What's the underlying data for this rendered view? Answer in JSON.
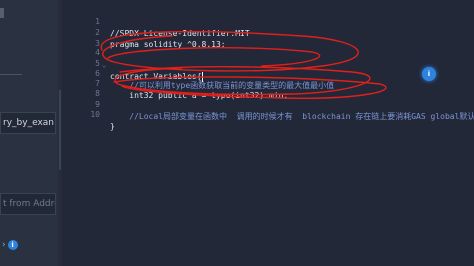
{
  "left_panel": {
    "contract_field_value": "ry_by_exan",
    "address_field_placeholder": "t from Addre"
  },
  "editor": {
    "lines": [
      {
        "num": "1",
        "text": "//SPDX-License-Identifier:MIT"
      },
      {
        "num": "2",
        "text": "pragma solidity ^0.8.13;"
      },
      {
        "num": "3",
        "text": ""
      },
      {
        "num": "4",
        "text": "contract Variables{"
      },
      {
        "num": "5",
        "text": ""
      },
      {
        "num": "6",
        "text": "    //可以利用type函数获取当前的变量类型的最大值最小值"
      },
      {
        "num": "7",
        "text": "    int32 public a = type(int32).min;"
      },
      {
        "num": "8",
        "text": ""
      },
      {
        "num": "9",
        "text": "    //Local局部变量在函数中  调用的时候才有  blockchain 存在链上要消耗GAS global默认的全局变量"
      },
      {
        "num": "10",
        "text": "}"
      }
    ]
  },
  "icons": {
    "deploy_info": "i",
    "floating_badge": "i"
  },
  "colors": {
    "annotation": "#e0201b",
    "accent": "#2f83e0"
  }
}
